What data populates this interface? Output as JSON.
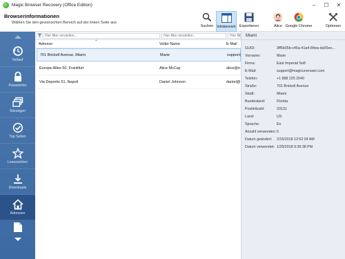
{
  "window": {
    "title": "Magic Browser Recovery (Office Edition)"
  },
  "header": {
    "title": "Browserinformationen",
    "subtitle": "Wählen Sie den gewünschten Bereich auf der linken Seite aus"
  },
  "toolbar": {
    "items": [
      {
        "label": "Suchen",
        "icon": "search-icon"
      },
      {
        "label": "Infobereich",
        "icon": "info-panel-icon",
        "active": true
      },
      {
        "label": "Exportieren",
        "icon": "save-icon"
      },
      {
        "label": "Alice",
        "icon": "user-avatar-icon"
      },
      {
        "label": "Google Chrome",
        "icon": "chrome-icon"
      },
      {
        "label": "Optionen",
        "icon": "tools-icon"
      }
    ]
  },
  "sidebar": {
    "items": [
      {
        "label": "Verlauf",
        "icon": "history-icon"
      },
      {
        "label": "Passwörter",
        "icon": "lock-icon"
      },
      {
        "label": "Sitzungen",
        "icon": "sessions-icon"
      },
      {
        "label": "Top Seiten",
        "icon": "check-icon"
      },
      {
        "label": "Lesezeichen",
        "icon": "star-icon"
      },
      {
        "label": "Downloads",
        "icon": "download-icon"
      },
      {
        "label": "Adressen",
        "icon": "home-icon",
        "active": true
      },
      {
        "label": "",
        "icon": "document-icon"
      }
    ]
  },
  "table": {
    "filter_placeholder": "Hier filter einstellen...",
    "columns": [
      "Adresse",
      "Voller Name",
      "E-Mail"
    ],
    "rows": [
      {
        "address": "701 Brickell Avenue, Miami",
        "name": "Marie",
        "email": "support@magicuneraser.com",
        "selected": true
      },
      {
        "address": "Europa-Allee 50, Frankfurt",
        "name": "Alice McCay",
        "email": "alice@mail.com",
        "selected": false
      },
      {
        "address": "Via Depretis 51, Napoli",
        "name": "Daniel Johnson",
        "email": "daniel@mail.com",
        "selected": false
      }
    ]
  },
  "details": {
    "title": "Miami",
    "fields": [
      {
        "key": "GUID:",
        "value": "3ff5b35b-c45a-41a4-84ea-da55ee..."
      },
      {
        "key": "Vorname:",
        "value": "Marie"
      },
      {
        "key": "Firma:",
        "value": "East Imperial Soft"
      },
      {
        "key": "E-Mail:",
        "value": "support@magicuneraser.com"
      },
      {
        "key": "Telefon:",
        "value": "+1 888 225 2040"
      },
      {
        "key": "Straße:",
        "value": "701 Brickell Avenue"
      },
      {
        "key": "Stadt:",
        "value": "Miami"
      },
      {
        "key": "Bundesland:",
        "value": "Florida"
      },
      {
        "key": "Postleitzahl:",
        "value": "33131"
      },
      {
        "key": "Land:",
        "value": "US"
      },
      {
        "key": "Sprache:",
        "value": "En"
      },
      {
        "key": "Anzahl verwenden:",
        "value": "5"
      },
      {
        "key": "Datum geändert:",
        "value": "2/15/2018 12:52:04 AM"
      },
      {
        "key": "Datum verwendet:",
        "value": "1/25/2018 9:39:38 PM"
      }
    ]
  },
  "colors": {
    "sidebar": "#3f6ea5",
    "sidebar_active": "#2b5289",
    "details_bg": "#e9eef4",
    "selection": "#e9f2fb"
  }
}
